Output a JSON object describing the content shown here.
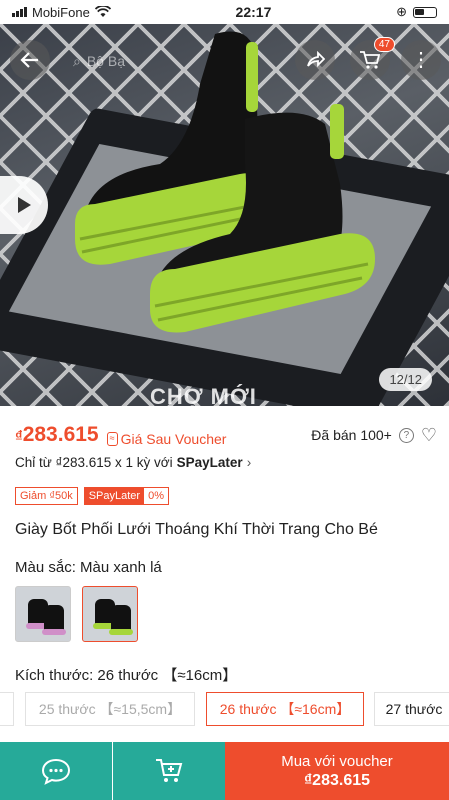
{
  "status": {
    "carrier": "MobiFone",
    "time": "22:17"
  },
  "image": {
    "search_hint": "Bộ Bạ",
    "page_counter": "12/12",
    "watermark": "CHỢ MỚI",
    "cart_count": "47"
  },
  "price": {
    "currency": "₫",
    "amount": "283.615",
    "voucher_label": "Giá Sau Voucher",
    "sold": "Đã bán 100+",
    "spaylater_prefix": "Chỉ từ ₫283.615 x 1 kỳ với",
    "spaylater_brand": "SPayLater"
  },
  "tags": {
    "discount": "Giảm ₫50k",
    "spaylater": "SPayLater",
    "spaylater_rate": "0%"
  },
  "product": {
    "title": "Giày Bốt Phối Lưới Thoáng Khí Thời Trang Cho Bé"
  },
  "color": {
    "label": "Màu sắc:",
    "value": "Màu xanh lá"
  },
  "size": {
    "label": "Kích thước:",
    "value": "26 thước 【≈16cm】",
    "options": [
      {
        "label": "25 thước 【≈15,5cm】"
      },
      {
        "label": "26 thước 【≈16cm】"
      },
      {
        "label": "27 thước"
      }
    ]
  },
  "bottom": {
    "buy_label": "Mua với voucher",
    "buy_amount": "₫283.615"
  },
  "colors": {
    "accent": "#ee4d2d",
    "teal": "#26aa99"
  }
}
